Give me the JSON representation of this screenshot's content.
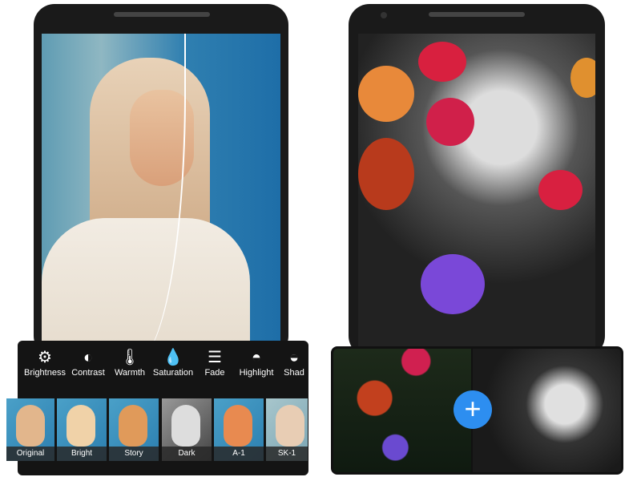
{
  "adjust_tools": [
    {
      "label": "Brightness",
      "icon": "sun-gear-icon",
      "glyph": "⚙"
    },
    {
      "label": "Contrast",
      "icon": "contrast-icon",
      "glyph": "◐"
    },
    {
      "label": "Warmth",
      "icon": "thermometer-icon",
      "glyph": "🌡"
    },
    {
      "label": "Saturation",
      "icon": "drop-icon",
      "glyph": "💧"
    },
    {
      "label": "Fade",
      "icon": "lines-icon",
      "glyph": "☰"
    },
    {
      "label": "Highlight",
      "icon": "highlight-icon",
      "glyph": "◓"
    },
    {
      "label": "Shad",
      "icon": "shadow-icon",
      "glyph": "◒"
    }
  ],
  "filters": [
    {
      "label": "Original"
    },
    {
      "label": "Bright"
    },
    {
      "label": "Story"
    },
    {
      "label": "Dark"
    },
    {
      "label": "A-1"
    },
    {
      "label": "SK-1"
    }
  ],
  "compare": {
    "add_glyph": "+"
  },
  "colors": {
    "accent": "#2d8ef0",
    "toolbar": "#141414"
  }
}
